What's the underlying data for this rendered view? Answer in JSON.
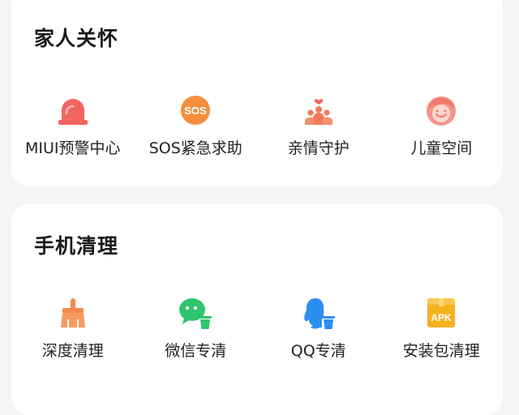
{
  "family_care": {
    "title": "家人关怀",
    "items": [
      {
        "label": "MIUI预警中心",
        "icon": "alarm-siren-icon",
        "color": "#f2655f"
      },
      {
        "label": "SOS紧急求助",
        "icon": "sos-icon",
        "icon_text": "SOS",
        "color": "#f58f3f"
      },
      {
        "label": "亲情守护",
        "icon": "family-guard-icon",
        "color": "#f27a5a"
      },
      {
        "label": "儿童空间",
        "icon": "child-face-icon",
        "color": "#f4958a"
      }
    ]
  },
  "phone_clean": {
    "title": "手机清理",
    "items": [
      {
        "label": "深度清理",
        "icon": "broom-icon",
        "color": "#f5894a"
      },
      {
        "label": "微信专清",
        "icon": "wechat-clean-icon",
        "color": "#2fc46e"
      },
      {
        "label": "QQ专清",
        "icon": "qq-clean-icon",
        "color": "#2a8ff0"
      },
      {
        "label": "安装包清理",
        "icon": "apk-icon",
        "icon_text": "APK",
        "color": "#f5b21f"
      }
    ]
  }
}
